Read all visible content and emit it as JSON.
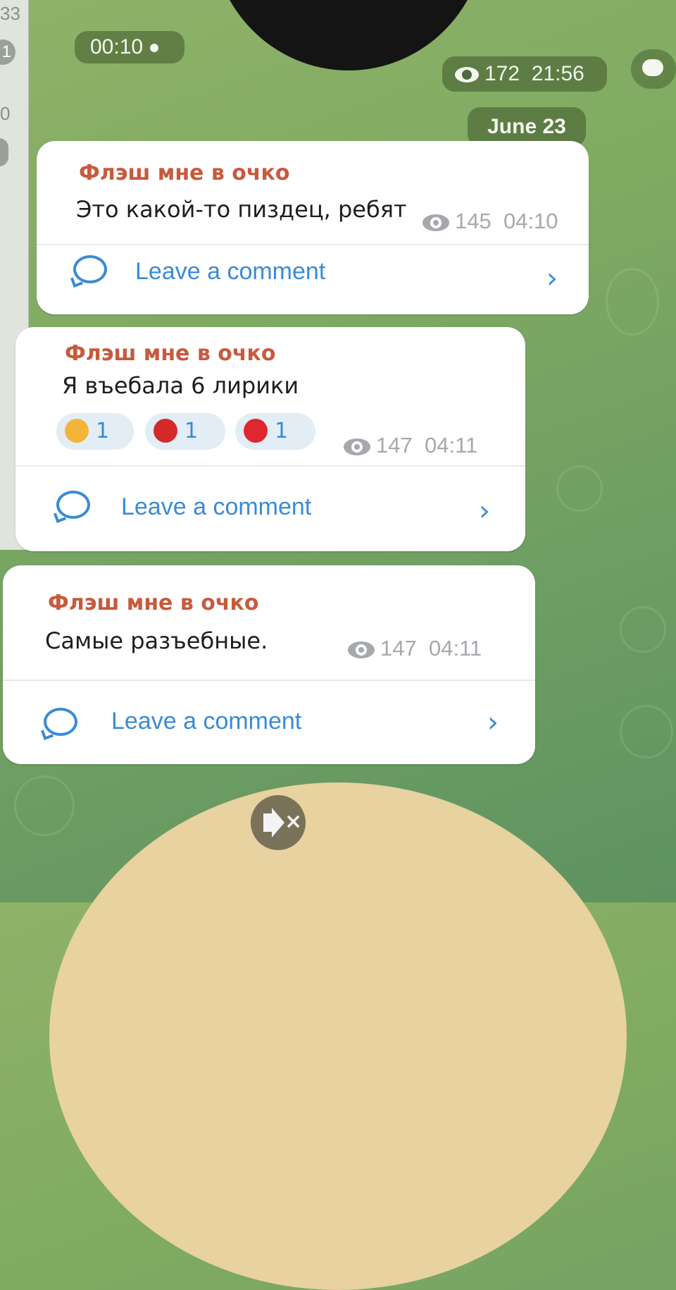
{
  "left_strip": {
    "items": [
      "33",
      "1",
      "0"
    ]
  },
  "video_note": {
    "duration": "00:10"
  },
  "header_meta": {
    "views": "172",
    "time": "21:56"
  },
  "date_separator": "June 23",
  "messages": [
    {
      "author": "Флэш мне в очко",
      "text": "Это какой-то пиздец, ребят",
      "views": "145",
      "time": "04:10",
      "comment_label": "Leave a comment"
    },
    {
      "author": "Флэш мне в очко",
      "text": "Я въебала 6 лирики",
      "views": "147",
      "time": "04:11",
      "comment_label": "Leave a comment",
      "reactions": [
        {
          "icon": "smiling-face-with-hearts-icon",
          "count": "1"
        },
        {
          "icon": "heart-on-fire-icon",
          "count": "1"
        },
        {
          "icon": "strawberry-icon",
          "count": "1"
        }
      ]
    },
    {
      "author": "Флэш мне в очко",
      "text": "Самые разъебные.",
      "views": "147",
      "time": "04:11",
      "comment_label": "Leave a comment"
    }
  ],
  "colors": {
    "author": "#c75a3e",
    "link": "#3a8bd6",
    "meta": "#a5a9ad"
  }
}
